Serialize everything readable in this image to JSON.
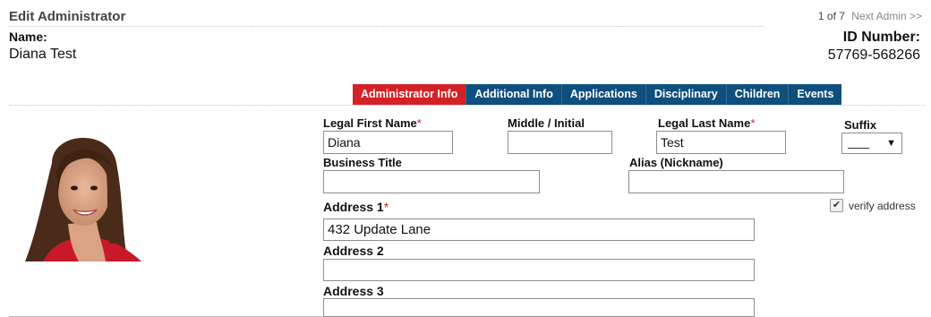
{
  "header": {
    "title": "Edit Administrator",
    "name_label": "Name:",
    "name_value": "Diana Test",
    "pager_count": "1 of 7",
    "pager_next": "Next Admin >>",
    "id_label": "ID Number:",
    "id_value": "57769-568266"
  },
  "tabs": [
    {
      "label": "Administrator Info",
      "active": true
    },
    {
      "label": "Additional Info",
      "active": false
    },
    {
      "label": "Applications",
      "active": false
    },
    {
      "label": "Disciplinary",
      "active": false
    },
    {
      "label": "Children",
      "active": false
    },
    {
      "label": "Events",
      "active": false
    }
  ],
  "form": {
    "first_name": {
      "label": "Legal First Name",
      "required_mark": "*",
      "value": "Diana"
    },
    "middle": {
      "label": "Middle / Initial",
      "value": ""
    },
    "last_name": {
      "label": "Legal Last Name",
      "required_mark": "*",
      "value": "Test"
    },
    "suffix": {
      "label": "Suffix",
      "value": "____"
    },
    "business_title": {
      "label": "Business Title",
      "value": ""
    },
    "alias": {
      "label": "Alias (Nickname)",
      "value": ""
    },
    "address1": {
      "label": "Address 1",
      "required_mark": "*",
      "value": "432 Update Lane"
    },
    "verify_address": {
      "label": "verify address",
      "checked": true
    },
    "address2": {
      "label": "Address 2",
      "value": ""
    },
    "address3": {
      "label": "Address 3",
      "value": ""
    }
  },
  "colors": {
    "active_tab": "#d42027",
    "tab": "#0e4f7e",
    "required": "#d42027"
  },
  "icons": {
    "suffix_dropdown": "chevron-down-icon",
    "verify_checkbox": "checkmark-icon"
  }
}
